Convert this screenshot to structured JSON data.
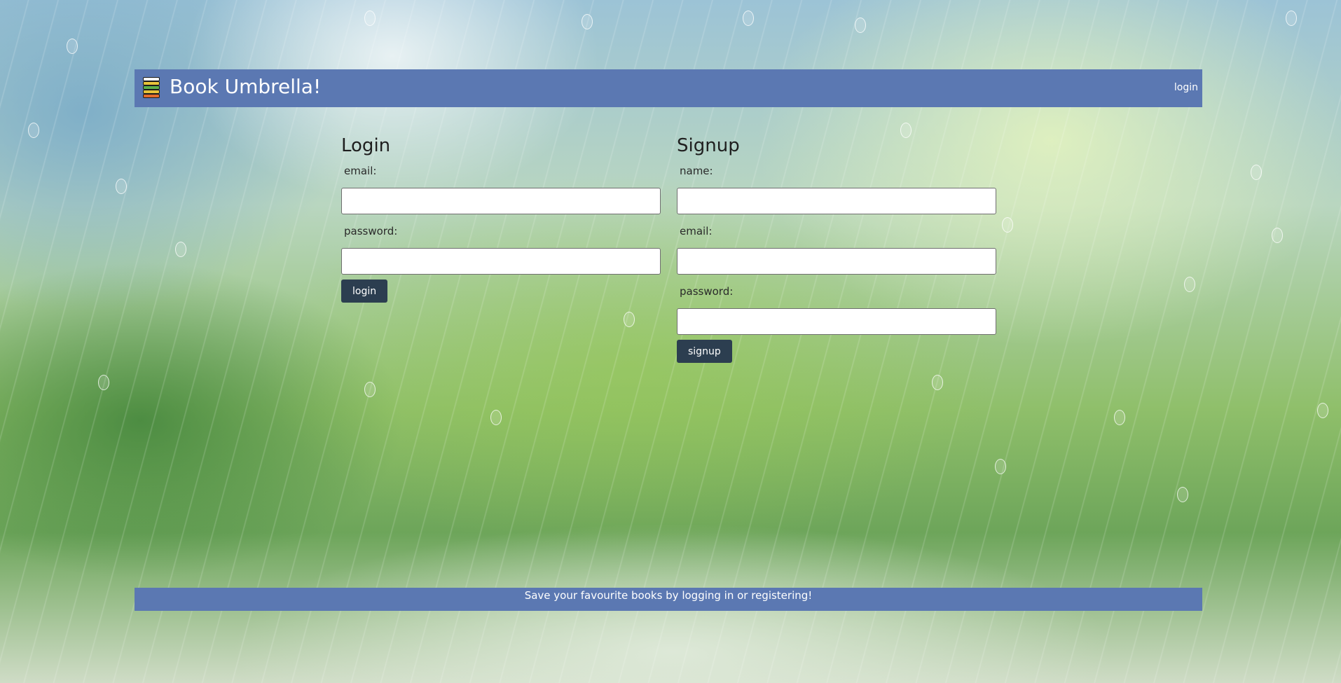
{
  "colors": {
    "bar_background": "#5b78b2",
    "button_background": "#2c3e50",
    "button_text": "#ffffff"
  },
  "header": {
    "logo_icon": "books-stack-icon",
    "site_title": "Book Umbrella!",
    "nav_login_label": "login"
  },
  "login": {
    "heading": "Login",
    "email_label": "email:",
    "email_value": "",
    "password_label": "password:",
    "password_value": "",
    "submit_label": "login"
  },
  "signup": {
    "heading": "Signup",
    "name_label": "name:",
    "name_value": "",
    "email_label": "email:",
    "email_value": "",
    "password_label": "password:",
    "password_value": "",
    "submit_label": "signup"
  },
  "footer": {
    "message": "Save your favourite books by logging in or registering!"
  }
}
